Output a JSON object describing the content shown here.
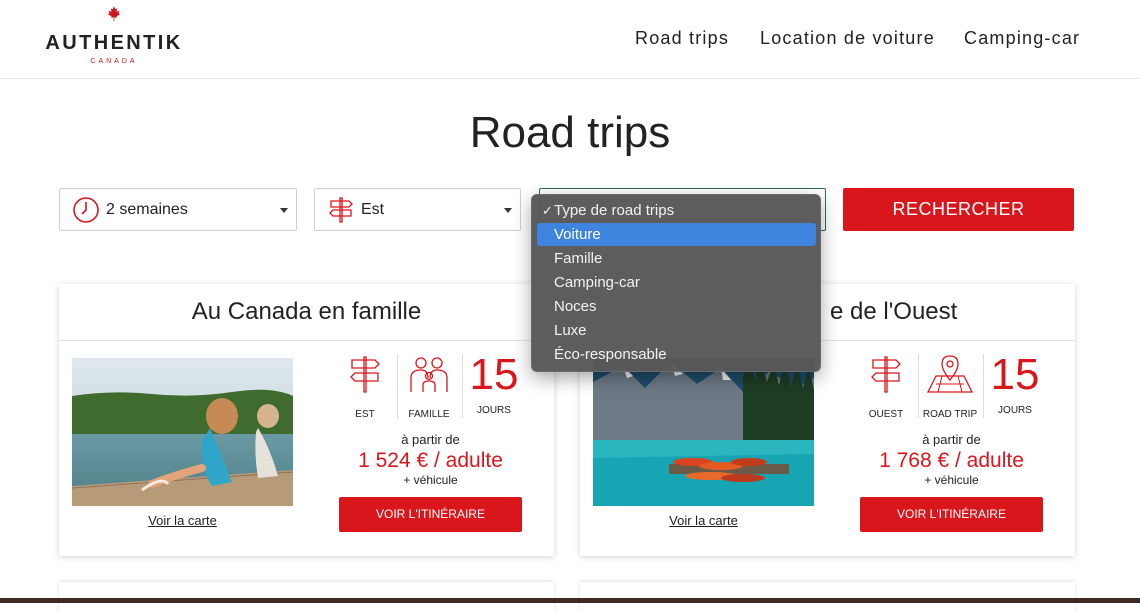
{
  "header": {
    "logo": {
      "brand": "AUTHENTIK",
      "sub": "CANADA"
    },
    "nav": [
      "Road trips",
      "Location de voiture",
      "Camping-car"
    ]
  },
  "main": {
    "title": "Road trips",
    "filters": {
      "duration": {
        "value": "2 semaines",
        "icon": "clock-icon"
      },
      "region": {
        "value": "Est",
        "icon": "signpost-icon"
      },
      "type": {
        "options": [
          "Type de road trips",
          "Voiture",
          "Famille",
          "Camping-car",
          "Noces",
          "Luxe",
          "Éco-responsable"
        ],
        "checked": "Type de road trips",
        "highlighted": "Voiture"
      },
      "search_label": "RECHERCHER"
    },
    "cards": [
      {
        "title": "Au Canada en famille",
        "features": [
          {
            "icon": "signpost-icon",
            "label": "EST"
          },
          {
            "icon": "family-icon",
            "label": "FAMILLE"
          }
        ],
        "days": "15",
        "days_label": "JOURS",
        "from": "à partir de",
        "price": "1 524 € / adulte",
        "vehicle": "+ véhicule",
        "cta": "VOIR L'ITINÉRAIRE",
        "map_link": "Voir la carte"
      },
      {
        "title_visible": "e de l'Ouest",
        "features": [
          {
            "icon": "signpost-icon",
            "label": "OUEST"
          },
          {
            "icon": "map-pin-icon",
            "label": "ROAD TRIP"
          }
        ],
        "days": "15",
        "days_label": "JOURS",
        "from": "à partir de",
        "price": "1 768 € / adulte",
        "vehicle": "+ véhicule",
        "cta": "VOIR L'ITINÉRAIRE",
        "map_link": "Voir la carte"
      }
    ]
  },
  "colors": {
    "accent": "#d9161c",
    "dropdown_bg": "#585858",
    "dropdown_highlight": "#3f84df"
  }
}
